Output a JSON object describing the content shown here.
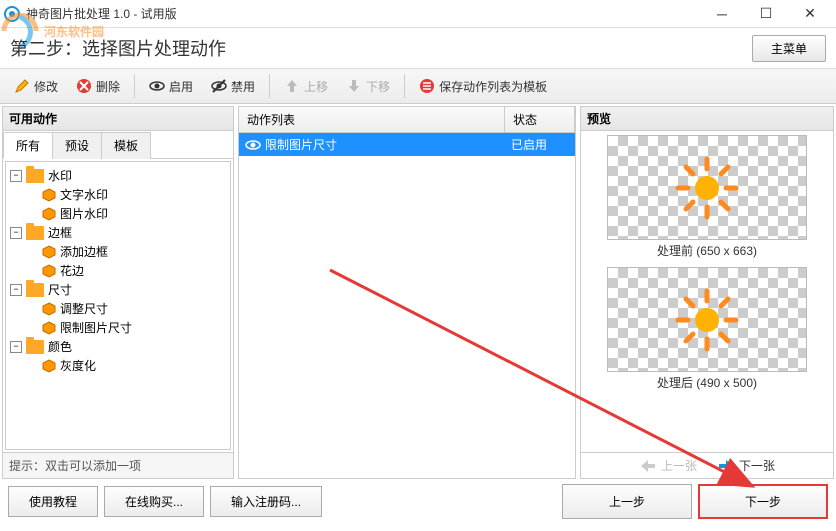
{
  "window": {
    "title": "神奇图片批处理 1.0 - 试用版"
  },
  "wizard": {
    "step_label": "第二步：选择图片处理动作",
    "main_menu": "主菜单"
  },
  "toolbar": {
    "modify": "修改",
    "delete": "删除",
    "enable": "启用",
    "disable": "禁用",
    "move_up": "上移",
    "move_down": "下移",
    "save_tpl": "保存动作列表为模板"
  },
  "left_panel": {
    "title": "可用动作",
    "tabs": {
      "all": "所有",
      "preset": "预设",
      "template": "模板"
    },
    "tree": {
      "cat_watermark": "水印",
      "text_wm": "文字水印",
      "image_wm": "图片水印",
      "cat_border": "边框",
      "add_border": "添加边框",
      "lace": "花边",
      "cat_size": "尺寸",
      "resize": "调整尺寸",
      "limit_size": "限制图片尺寸",
      "cat_color": "颜色",
      "grayscale": "灰度化"
    },
    "hint": "提示：双击可以添加一项"
  },
  "action_list": {
    "col_name": "动作列表",
    "col_status": "状态",
    "rows": [
      {
        "name": "限制图片尺寸",
        "status": "已启用"
      }
    ]
  },
  "preview": {
    "title": "预览",
    "before_label": "处理前 (650 x 663)",
    "after_label": "处理后 (490 x 500)",
    "prev_img": "上一张",
    "next_img": "下一张"
  },
  "footer": {
    "tutorial": "使用教程",
    "buy": "在线购买...",
    "regcode": "输入注册码...",
    "prev_step": "上一步",
    "next_step": "下一步"
  },
  "watermark_text": "河东软件园"
}
